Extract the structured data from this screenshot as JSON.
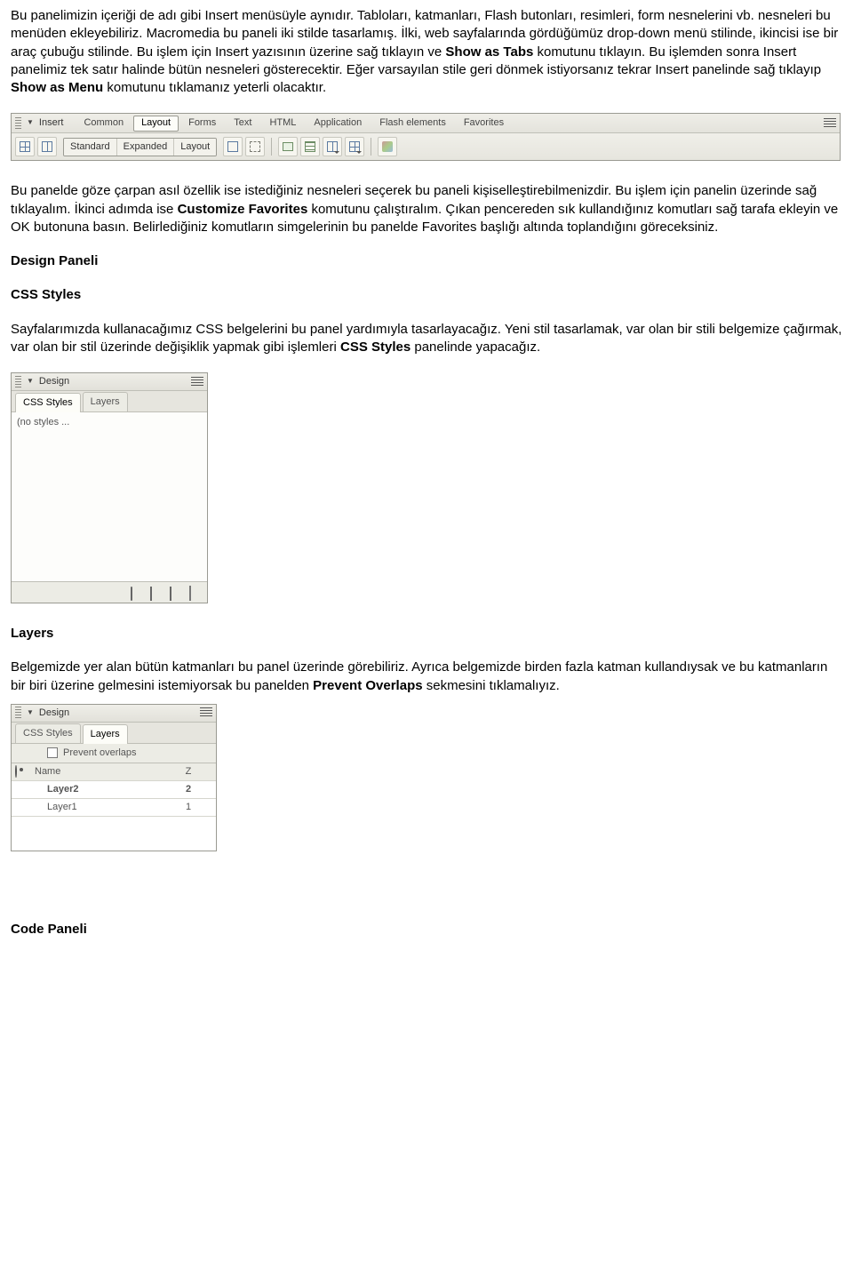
{
  "paragraphs": {
    "p1_a": "Bu panelimizin içeriği de adı gibi Insert menüsüyle aynıdır. Tabloları, katmanları, Flash butonları, resimleri, form nesnelerini vb. nesneleri bu menüden ekleyebiliriz. Macromedia bu paneli iki stilde tasarlamış. İlki, web sayfalarında gördüğümüz drop-down menü stilinde, ikincisi ise bir araç çubuğu stilinde. Bu işlem için Insert yazısının üzerine sağ tıklayın ve ",
    "p1_b": " komutunu tıklayın. Bu işlemden sonra Insert panelimiz tek satır halinde bütün nesneleri gösterecektir. Eğer varsayılan stile geri dönmek istiyorsanız tekrar Insert panelinde sağ tıklayıp ",
    "p1_c": " komutunu tıklamanız yeterli olacaktır.",
    "p1_bold1": "Show as Tabs",
    "p1_bold2": "Show as Menu",
    "p2_a": "Bu panelde göze çarpan asıl özellik ise istediğiniz nesneleri seçerek bu paneli kişiselleştirebilmenizdir. Bu işlem için panelin üzerinde sağ tıklayalım. İkinci adımda ise ",
    "p2_bold": "Customize Favorites",
    "p2_b": " komutunu çalıştıralım. Çıkan pencereden sık kullandığınız komutları sağ tarafa ekleyin ve OK butonuna basın. Belirlediğiniz komutların simgelerinin bu panelde Favorites başlığı altında toplandığını göreceksiniz.",
    "h_design": "Design Paneli",
    "h_css": "CSS Styles",
    "p3_a": "Sayfalarımızda kullanacağımız CSS belgelerini bu panel yardımıyla tasarlayacağız. Yeni stil tasarlamak, var olan bir stili belgemize çağırmak, var olan bir stil üzerinde değişiklik yapmak gibi işlemleri ",
    "p3_bold": "CSS Styles",
    "p3_b": " panelinde yapacağız.",
    "h_layers": "Layers",
    "p4_a": "Belgemizde yer alan bütün katmanları bu panel üzerinde görebiliriz. Ayrıca belgemizde birden fazla katman kullandıysak ve bu katmanların bir biri üzerine gelmesini istemiyorsak bu panelden ",
    "p4_bold": "Prevent Overlaps",
    "p4_b": " sekmesini tıklamalıyız.",
    "h_code": "Code Paneli"
  },
  "insert_bar": {
    "title": "Insert",
    "tabs": [
      "Common",
      "Layout",
      "Forms",
      "Text",
      "HTML",
      "Application",
      "Flash elements",
      "Favorites"
    ],
    "activeTab": 1,
    "seg": [
      "Standard",
      "Expanded",
      "Layout"
    ]
  },
  "design_panel": {
    "title": "Design",
    "tabs": [
      "CSS Styles",
      "Layers"
    ],
    "no_styles": "(no styles ..."
  },
  "layers_panel": {
    "title": "Design",
    "tabs": [
      "CSS Styles",
      "Layers"
    ],
    "prevent": "Prevent overlaps",
    "cols": {
      "name": "Name",
      "z": "Z"
    },
    "rows": [
      {
        "name": "Layer2",
        "z": "2"
      },
      {
        "name": "Layer1",
        "z": "1"
      }
    ]
  }
}
